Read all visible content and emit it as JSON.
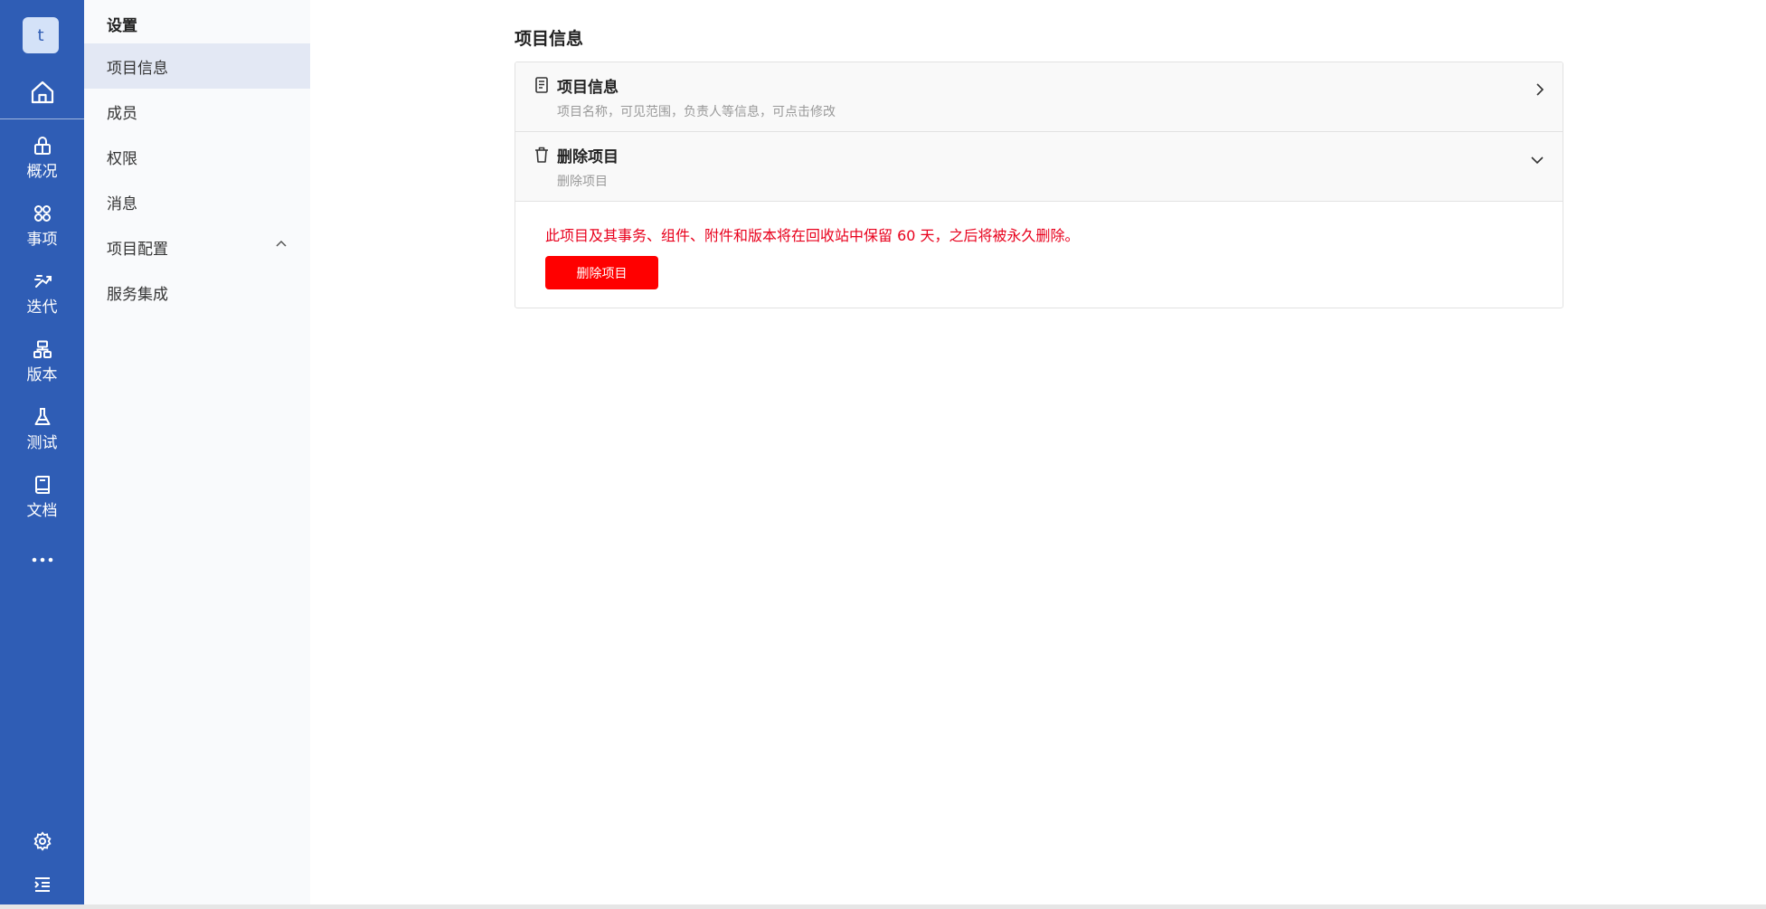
{
  "rail": {
    "avatar_letter": "t",
    "items": [
      {
        "label": "概况",
        "icon": "overview-icon"
      },
      {
        "label": "事项",
        "icon": "workitem-icon"
      },
      {
        "label": "迭代",
        "icon": "sprint-icon"
      },
      {
        "label": "版本",
        "icon": "version-icon"
      },
      {
        "label": "测试",
        "icon": "test-icon"
      },
      {
        "label": "文档",
        "icon": "doc-icon"
      }
    ]
  },
  "subnav": {
    "title": "设置",
    "items": [
      {
        "label": "项目信息",
        "active": true
      },
      {
        "label": "成员"
      },
      {
        "label": "权限"
      },
      {
        "label": "消息"
      },
      {
        "label": "项目配置",
        "expandable": true
      },
      {
        "label": "服务集成"
      }
    ]
  },
  "main": {
    "title": "项目信息",
    "sections": [
      {
        "title": "项目信息",
        "desc": "项目名称，可见范围，负责人等信息，可点击修改"
      },
      {
        "title": "删除项目",
        "desc": "删除项目"
      }
    ],
    "delete": {
      "warning": "此项目及其事务、组件、附件和版本将在回收站中保留 60 天，之后将被永久删除。",
      "button_label": "删除项目"
    }
  },
  "colors": {
    "rail_bg": "#2f5db5",
    "danger": "#ff0000",
    "warning_text": "#e8001c"
  }
}
